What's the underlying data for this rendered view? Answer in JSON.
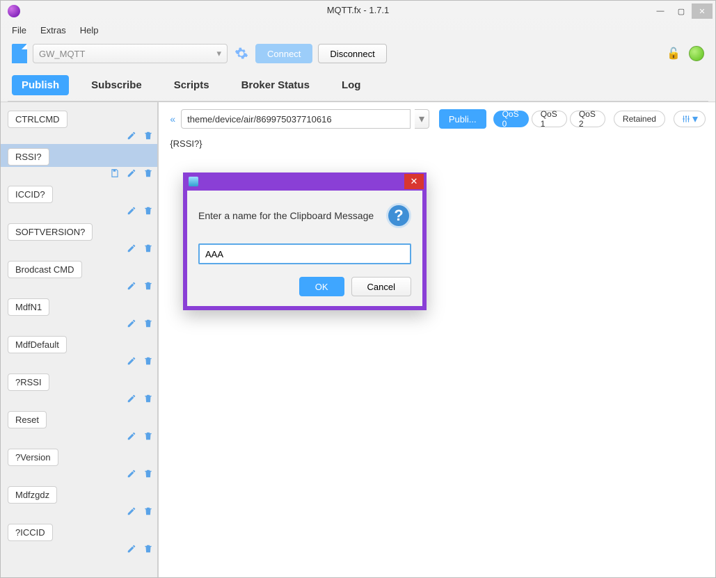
{
  "window": {
    "title": "MQTT.fx - 1.7.1"
  },
  "menu": {
    "file": "File",
    "extras": "Extras",
    "help": "Help"
  },
  "connection": {
    "profile": "GW_MQTT",
    "connect": "Connect",
    "disconnect": "Disconnect"
  },
  "tabs": {
    "publish": "Publish",
    "subscribe": "Subscribe",
    "scripts": "Scripts",
    "broker_status": "Broker Status",
    "log": "Log"
  },
  "sidebar": {
    "items": [
      {
        "label": "CTRLCMD"
      },
      {
        "label": "RSSI?"
      },
      {
        "label": "ICCID?"
      },
      {
        "label": "SOFTVERSION?"
      },
      {
        "label": "Brodcast CMD"
      },
      {
        "label": "MdfN1"
      },
      {
        "label": "MdfDefault"
      },
      {
        "label": "?RSSI"
      },
      {
        "label": "Reset"
      },
      {
        "label": "?Version"
      },
      {
        "label": "Mdfzgdz"
      },
      {
        "label": "?ICCID"
      }
    ],
    "selected_index": 1
  },
  "publish": {
    "topic": "theme/device/air/869975037710616",
    "button": "Publi...",
    "qos": {
      "q0": "QoS 0",
      "q1": "QoS 1",
      "q2": "QoS 2"
    },
    "retained": "Retained",
    "payload": "{RSSI?}"
  },
  "dialog": {
    "message": "Enter a name for the Clipboard Message",
    "input_value": "AAA",
    "ok": "OK",
    "cancel": "Cancel"
  }
}
